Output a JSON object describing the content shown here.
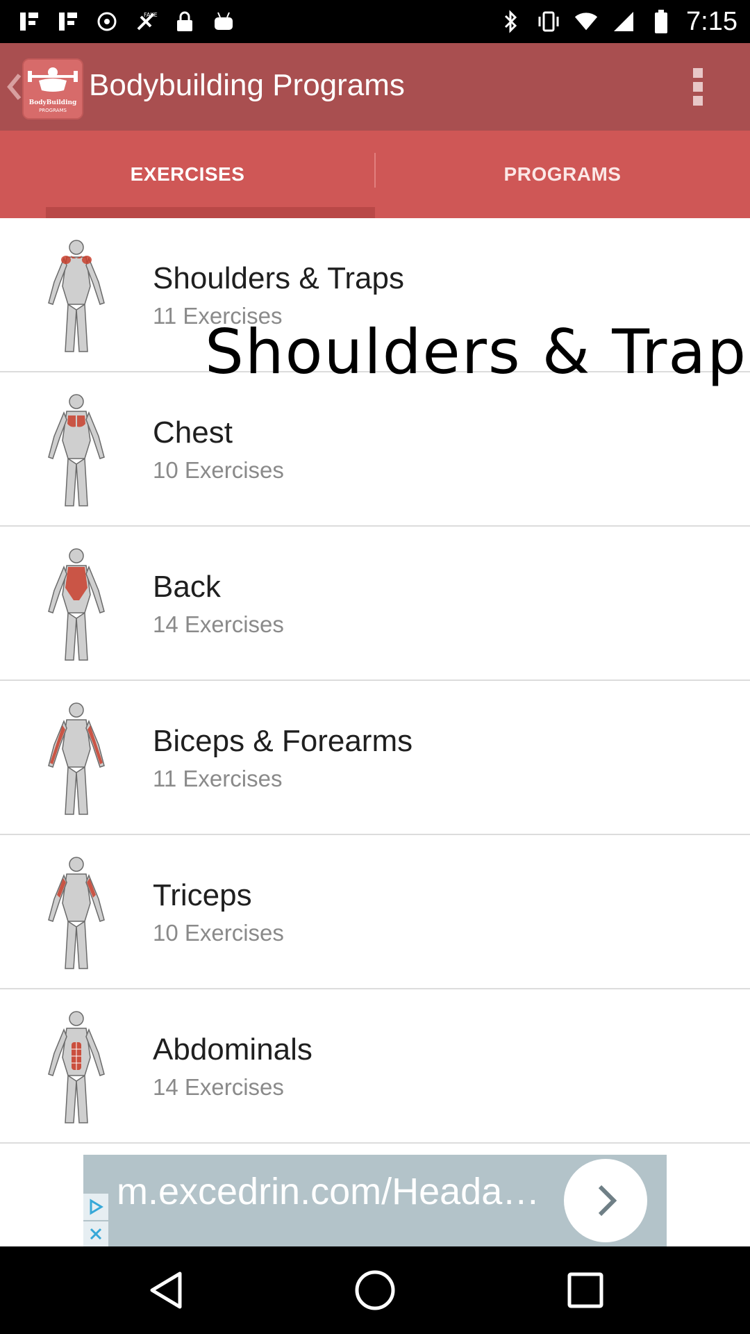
{
  "status_bar": {
    "time": "7:15",
    "left_icons": [
      "notification-icon",
      "notification-icon",
      "sync-icon",
      "fake-gps-icon",
      "lock-icon",
      "android-icon"
    ],
    "right_icons": [
      "bluetooth-icon",
      "vibrate-icon",
      "wifi-icon",
      "signal-icon",
      "battery-icon"
    ]
  },
  "app_bar": {
    "title": "Bodybuilding Programs",
    "logo_text_line1": "BodyBuilding",
    "logo_text_line2": "PROGRAMS"
  },
  "tabs": [
    {
      "label": "EXERCISES",
      "selected": true
    },
    {
      "label": "PROGRAMS",
      "selected": false
    }
  ],
  "exercises": [
    {
      "title": "Shoulders & Traps",
      "count": "11 Exercises",
      "highlight": "shoulders"
    },
    {
      "title": "Chest",
      "count": "10 Exercises",
      "highlight": "chest"
    },
    {
      "title": "Back",
      "count": "14 Exercises",
      "highlight": "back"
    },
    {
      "title": "Biceps & Forearms",
      "count": "11 Exercises",
      "highlight": "biceps"
    },
    {
      "title": "Triceps",
      "count": "10 Exercises",
      "highlight": "triceps"
    },
    {
      "title": "Abdominals",
      "count": "14 Exercises",
      "highlight": "abs"
    }
  ],
  "overlay": {
    "text": "Shoulders & Trap"
  },
  "ad": {
    "url_text": "m.excedrin.com/Heada…"
  },
  "colors": {
    "app_bar": "#a94f50",
    "tab_bar": "#cf5756",
    "muscle_highlight": "#c9402e"
  }
}
